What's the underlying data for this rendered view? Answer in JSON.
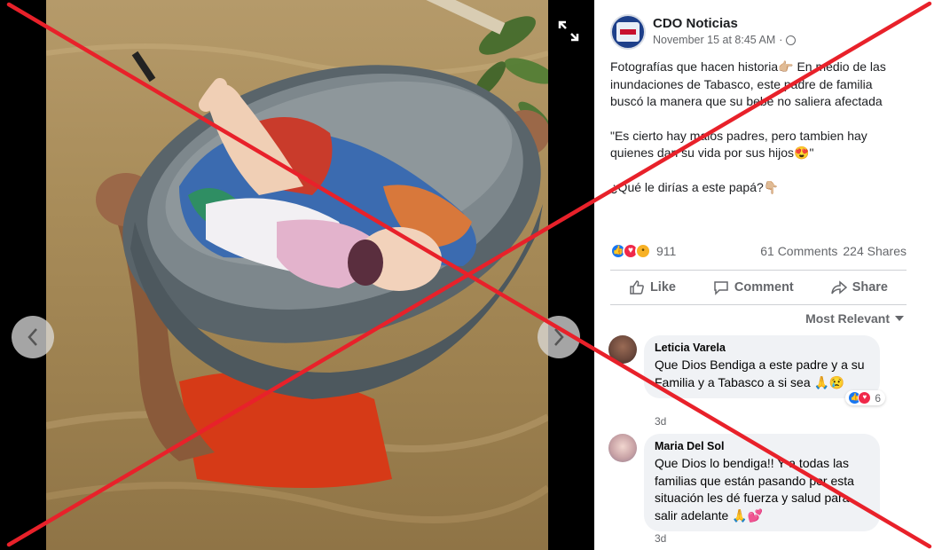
{
  "post": {
    "page_name": "CDO Noticias",
    "timestamp": "November 15 at 8:45 AM",
    "body": [
      "Fotografías que hacen historia👉🏼 En medio de las inundaciones de Tabasco, este padre de familia buscó la manera que su bebé no saliera afectada",
      "\"Es cierto hay malos padres, pero tambien hay quienes dan su vida por sus hijos😍\"",
      "¿Qué le dirías a este papá?👇🏼"
    ],
    "reactions_count": "911",
    "comments_count": "61 Comments",
    "shares_count": "224 Shares"
  },
  "actions": {
    "like": "Like",
    "comment": "Comment",
    "share": "Share"
  },
  "sort_label": "Most Relevant",
  "comments": [
    {
      "name": "Leticia Varela",
      "text": "Que Dios Bendiga a este padre y a su Familia y a Tabasco a si sea 🙏😢",
      "time": "3d",
      "reactions": "6"
    },
    {
      "name": "Maria Del Sol",
      "text": "Que Dios lo bendiga!! Y a todas las familias que están pasando por esta situación les dé fuerza y salud para salir adelante 🙏💕",
      "time": "3d"
    }
  ],
  "icons": {
    "expand": "expand-icon",
    "prev": "chevron-left-icon",
    "next": "chevron-right-icon",
    "like": "thumbs-up-icon",
    "comment": "comment-bubble-icon",
    "share": "share-arrow-icon",
    "privacy": "globe-icon"
  },
  "colors": {
    "overlay_x": "#e8212a",
    "link_blue": "#1877f2",
    "love_red": "#f02849",
    "muted_text": "#65676b"
  }
}
